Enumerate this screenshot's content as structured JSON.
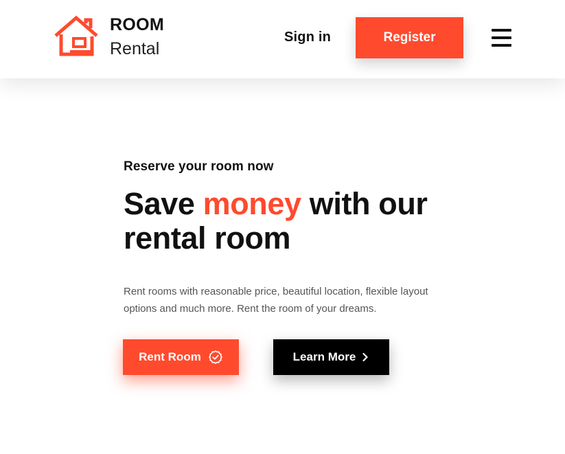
{
  "header": {
    "logo": {
      "line1": "ROOM",
      "line2": "Rental"
    },
    "signin_label": "Sign in",
    "register_label": "Register",
    "menu_icon": "hamburger-menu-icon"
  },
  "hero": {
    "eyebrow": "Reserve your room now",
    "headline": {
      "part1": "Save ",
      "accent": "money",
      "part2": " with our rental room"
    },
    "description": "Rent rooms with reasonable price, beautiful location, flexible layout options and much more. Rent the room of your dreams.",
    "buttons": {
      "primary_label": "Rent Room",
      "primary_icon": "verified-badge-icon",
      "secondary_label": "Learn More",
      "secondary_icon": "chevron-right-icon"
    }
  },
  "colors": {
    "accent": "#ff4a2e",
    "text": "#111111",
    "muted": "#555555",
    "background": "#ffffff"
  }
}
